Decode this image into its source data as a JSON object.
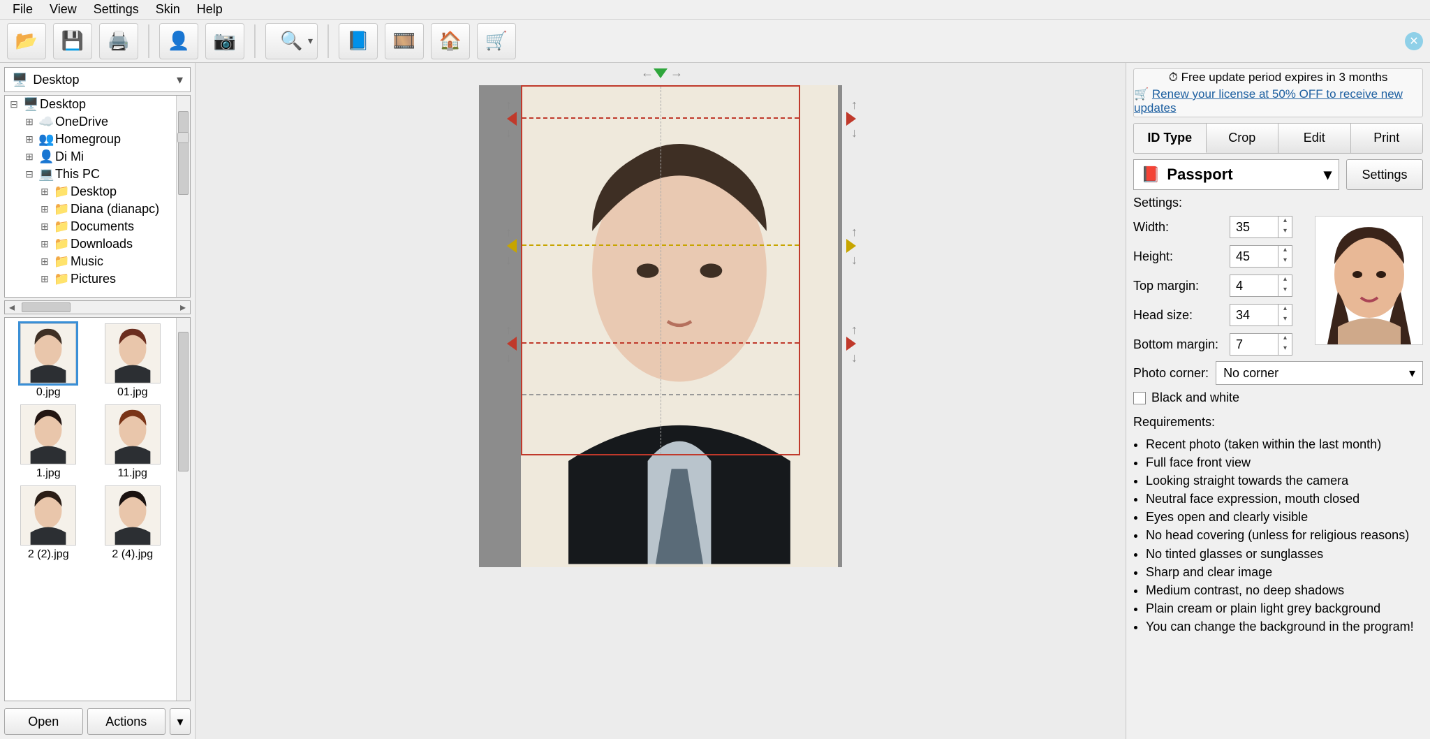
{
  "menu": {
    "items": [
      "File",
      "View",
      "Settings",
      "Skin",
      "Help"
    ]
  },
  "toolbar": {
    "icons": [
      "open-icon",
      "save-icon",
      "print-icon",
      "profile-icon",
      "camera-icon",
      "search-icon",
      "help-icon",
      "video-icon",
      "home-icon",
      "cart-icon"
    ]
  },
  "banner": {
    "line1_prefix": "⏱",
    "line1": "Free update period expires in 3 months",
    "line2_prefix": "🛒",
    "line2": "Renew your license at 50% OFF to receive new updates"
  },
  "left": {
    "path": "Desktop",
    "tree": [
      {
        "indent": 0,
        "exp": "⊟",
        "ico": "🖥️",
        "label": "Desktop"
      },
      {
        "indent": 1,
        "exp": "⊞",
        "ico": "☁️",
        "label": "OneDrive"
      },
      {
        "indent": 1,
        "exp": "⊞",
        "ico": "👥",
        "label": "Homegroup"
      },
      {
        "indent": 1,
        "exp": "⊞",
        "ico": "👤",
        "label": "Di Mi"
      },
      {
        "indent": 1,
        "exp": "⊟",
        "ico": "💻",
        "label": "This PC"
      },
      {
        "indent": 2,
        "exp": "⊞",
        "ico": "📁",
        "label": "Desktop"
      },
      {
        "indent": 2,
        "exp": "⊞",
        "ico": "📁",
        "label": "Diana (dianapc)"
      },
      {
        "indent": 2,
        "exp": "⊞",
        "ico": "📁",
        "label": "Documents"
      },
      {
        "indent": 2,
        "exp": "⊞",
        "ico": "📁",
        "label": "Downloads"
      },
      {
        "indent": 2,
        "exp": "⊞",
        "ico": "📁",
        "label": "Music"
      },
      {
        "indent": 2,
        "exp": "⊞",
        "ico": "📁",
        "label": "Pictures"
      }
    ],
    "thumbs": [
      {
        "name": "0.jpg",
        "selected": true
      },
      {
        "name": "01.jpg",
        "selected": false
      },
      {
        "name": "1.jpg",
        "selected": false
      },
      {
        "name": "11.jpg",
        "selected": false
      },
      {
        "name": "2 (2).jpg",
        "selected": false
      },
      {
        "name": "2 (4).jpg",
        "selected": false
      }
    ],
    "open_btn": "Open",
    "actions_btn": "Actions"
  },
  "right": {
    "tabs": [
      "ID Type",
      "Crop",
      "Edit",
      "Print"
    ],
    "active_tab": 0,
    "id_type": "Passport",
    "settings_btn": "Settings",
    "settings_label": "Settings:",
    "fields": {
      "width_label": "Width:",
      "width": "35",
      "height_label": "Height:",
      "height": "45",
      "top_margin_label": "Top margin:",
      "top_margin": "4",
      "head_size_label": "Head size:",
      "head_size": "34",
      "bottom_margin_label": "Bottom margin:",
      "bottom_margin": "7"
    },
    "corner_label": "Photo corner:",
    "corner_value": "No corner",
    "bw_label": "Black and white",
    "requirements_label": "Requirements:",
    "requirements": [
      "Recent photo (taken within the last month)",
      "Full face front view",
      "Looking straight towards the camera",
      "Neutral face expression, mouth closed",
      "Eyes open and clearly visible",
      "No head covering (unless for religious reasons)",
      "No tinted glasses or sunglasses",
      "Sharp and clear image",
      "Medium contrast, no deep shadows",
      "Plain cream or plain light grey background",
      "You can change the background in the program!"
    ]
  }
}
